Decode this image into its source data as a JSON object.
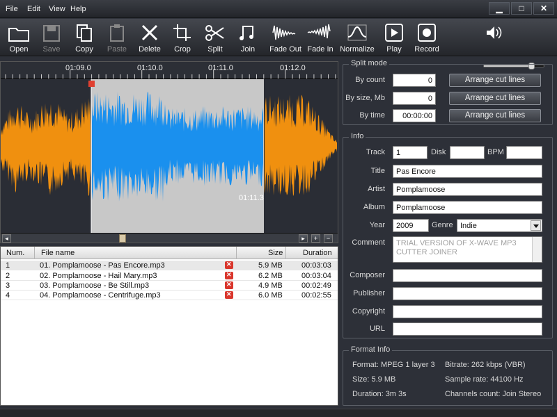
{
  "menu": [
    "File",
    "Edit",
    "View",
    "Help"
  ],
  "window_controls": {
    "minimize": "▁",
    "maximize": "□",
    "close": "✕"
  },
  "toolbar": [
    {
      "label": "Open",
      "icon": "folder-icon",
      "enabled": true
    },
    {
      "label": "Save",
      "icon": "floppy-icon",
      "enabled": false
    },
    {
      "label": "Copy",
      "icon": "copy-icon",
      "enabled": true
    },
    {
      "label": "Paste",
      "icon": "paste-icon",
      "enabled": false
    },
    {
      "label": "Delete",
      "icon": "delete-icon",
      "enabled": true
    },
    {
      "label": "Crop",
      "icon": "crop-icon",
      "enabled": true
    },
    {
      "label": "Split",
      "icon": "scissors-icon",
      "enabled": true
    },
    {
      "label": "Join",
      "icon": "notes-icon",
      "enabled": true
    },
    {
      "label": "Fade Out",
      "icon": "fade-out-icon",
      "enabled": true
    },
    {
      "label": "Fade In",
      "icon": "fade-in-icon",
      "enabled": true
    },
    {
      "label": "Normalize",
      "icon": "normalize-icon",
      "enabled": true
    },
    {
      "label": "Play",
      "icon": "play-icon",
      "enabled": true
    },
    {
      "label": "Record",
      "icon": "record-icon",
      "enabled": true
    }
  ],
  "volume": {
    "level": 0.78
  },
  "timeline": {
    "labels": [
      "01:09.0",
      "01:10.0",
      "01:11.0",
      "01:12.0"
    ],
    "cursor_time": "01:11.3"
  },
  "waveform": {
    "selection_color": "#1a90ee",
    "unselected_color": "#f0900f",
    "selection_bg": "#c8c8c8",
    "background": "#2a2d35"
  },
  "scroll": {
    "left": "◂",
    "right": "▸",
    "zoom_in": "+",
    "zoom_out": "−"
  },
  "file_list": {
    "columns": [
      "Num.",
      "File name",
      "Size",
      "Duration"
    ],
    "rows": [
      {
        "num": "1",
        "name": "01. Pomplamoose - Pas Encore.mp3",
        "size": "5.9 MB",
        "duration": "00:03:03"
      },
      {
        "num": "2",
        "name": "02. Pomplamoose - Hail Mary.mp3",
        "size": "6.2 MB",
        "duration": "00:03:04"
      },
      {
        "num": "3",
        "name": "03. Pomplamoose - Be Still.mp3",
        "size": "4.9 MB",
        "duration": "00:02:49"
      },
      {
        "num": "4",
        "name": "04. Pomplamoose - Centrifuge.mp3",
        "size": "6.0 MB",
        "duration": "00:02:55"
      }
    ]
  },
  "split_mode": {
    "title": "Split mode",
    "by_count_label": "By count",
    "by_count_value": "0",
    "by_size_label": "By size, Mb",
    "by_size_value": "0",
    "by_time_label": "By time",
    "by_time_value": "00:00:00",
    "button_label": "Arrange cut lines"
  },
  "info": {
    "title": "Info",
    "track_label": "Track",
    "track": "1",
    "disk_label": "Disk",
    "disk": "",
    "bpm_label": "BPM",
    "bpm": "",
    "title_label": "Title",
    "song_title": "Pas Encore",
    "artist_label": "Artist",
    "artist": "Pomplamoose",
    "album_label": "Album",
    "album": "Pomplamoose",
    "year_label": "Year",
    "year": "2009",
    "genre_label": "Genre",
    "genre": "Indie",
    "comment_label": "Comment",
    "comment": "TRIAL VERSION OF X-WAVE MP3 CUTTER JOINER",
    "composer_label": "Composer",
    "composer": "",
    "publisher_label": "Publisher",
    "publisher": "",
    "copyright_label": "Copyright",
    "copyright": "",
    "url_label": "URL",
    "url": ""
  },
  "format_info": {
    "title": "Format Info",
    "format": "Format: MPEG 1 layer 3",
    "bitrate": "Bitrate: 262 kbps (VBR)",
    "size": "Size: 5.9 MB",
    "sample_rate": "Sample rate: 44100 Hz",
    "duration": "Duration: 3m 3s",
    "channels": "Channels count: Join Stereo"
  }
}
